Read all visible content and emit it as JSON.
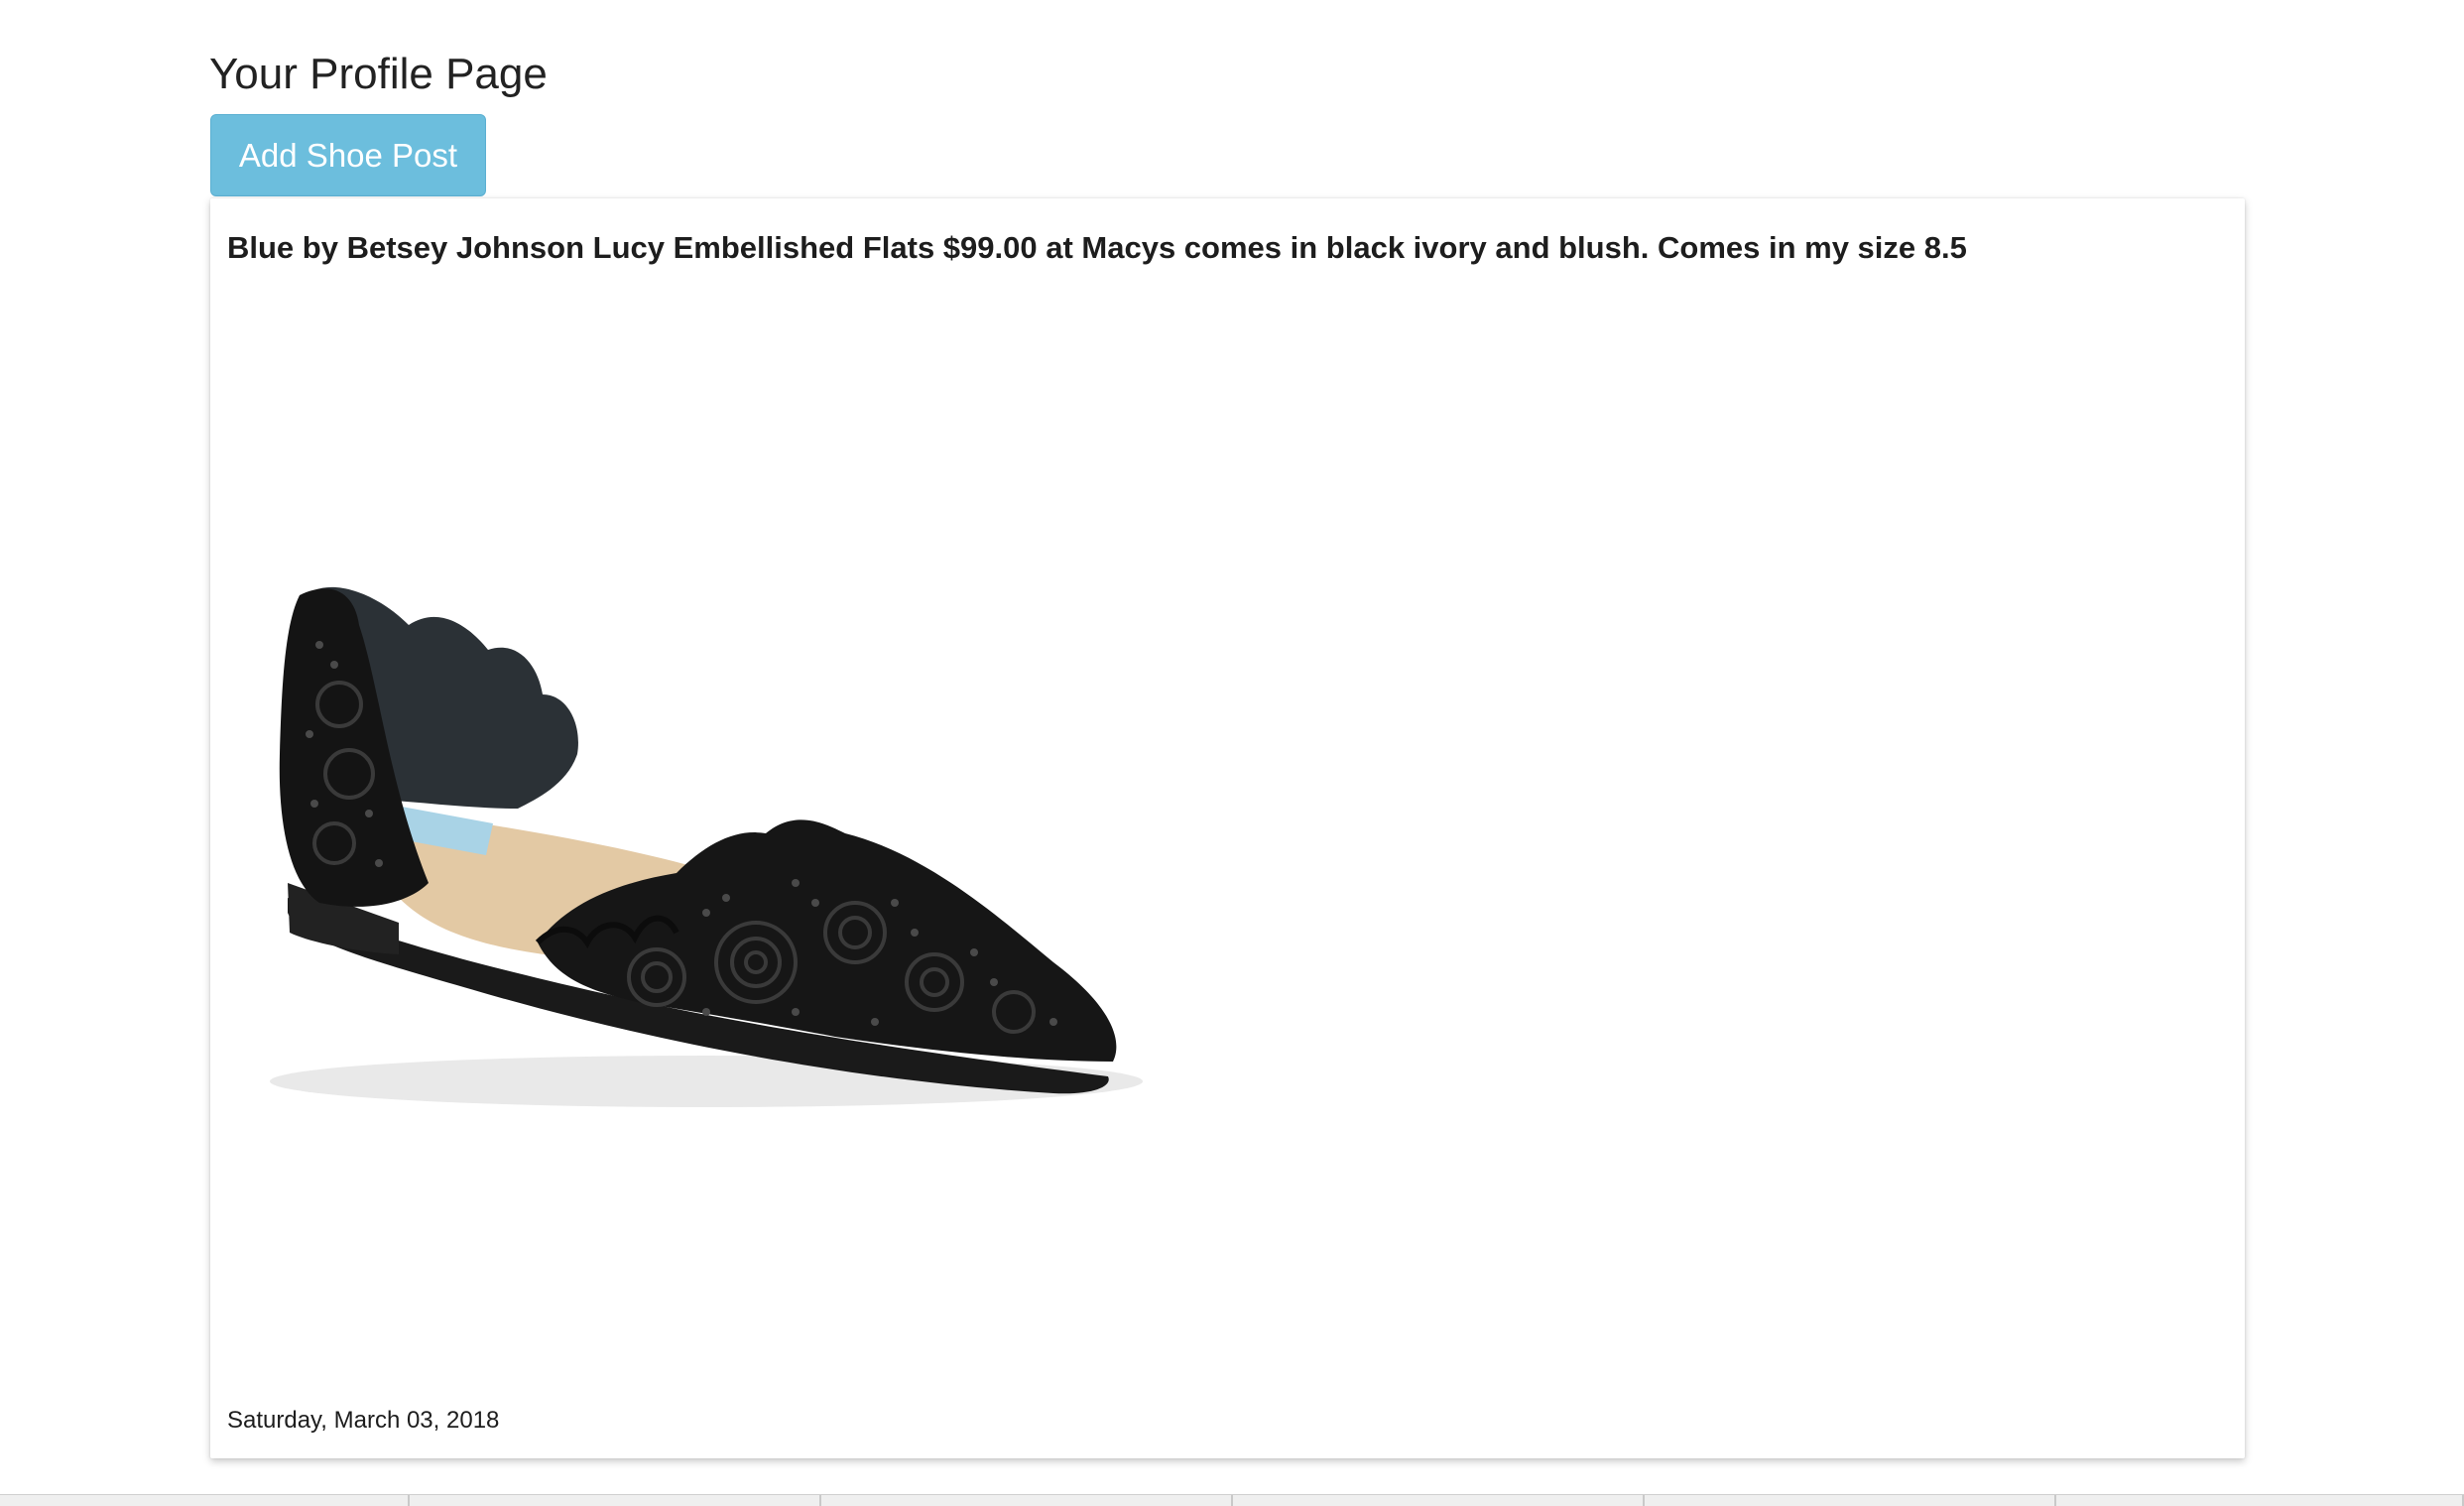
{
  "page": {
    "title": "Your Profile Page"
  },
  "toolbar": {
    "add_label": "Add Shoe Post",
    "accent_color": "#6cbedd"
  },
  "post": {
    "description": "Blue by Betsey Johnson Lucy Embellished Flats $99.00 at Macys comes in black ivory and blush. Comes in my size 8.5",
    "image_icon": "shoe-photo",
    "date": "Saturday, March 03, 2018"
  }
}
